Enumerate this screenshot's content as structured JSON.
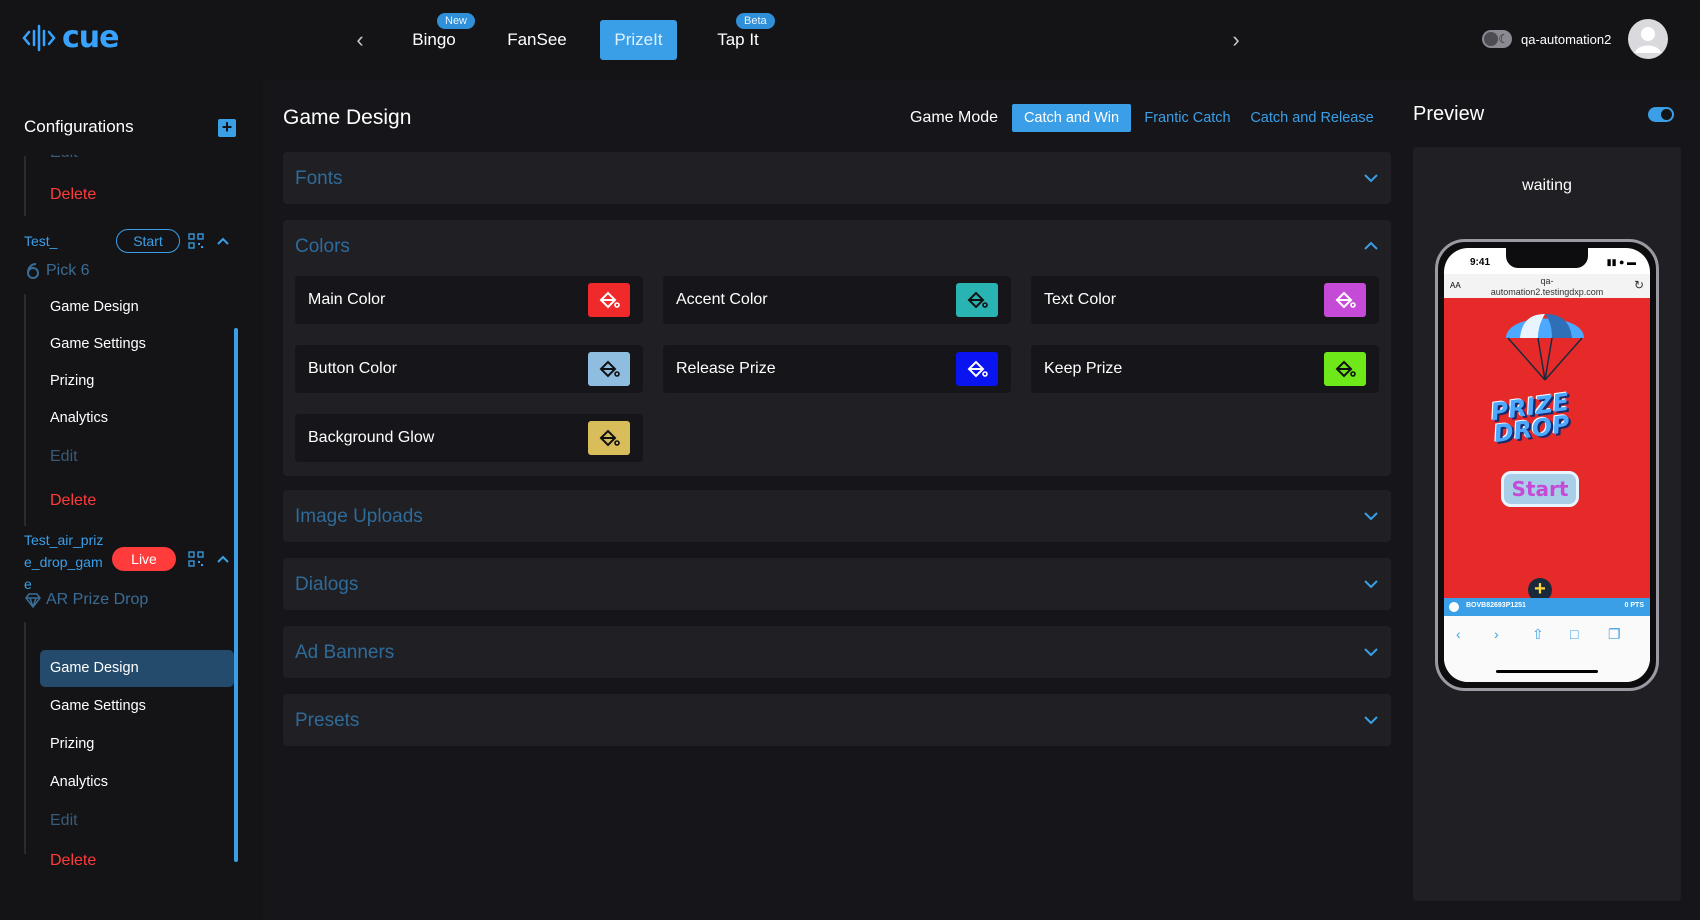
{
  "app": {
    "logo_text": "cue",
    "nav_tabs": [
      {
        "label": "Bingo",
        "badge": "New"
      },
      {
        "label": "FanSee",
        "badge": ""
      },
      {
        "label": "PrizeIt",
        "badge": ""
      },
      {
        "label": "Tap It",
        "badge": "Beta"
      }
    ],
    "username": "qa-automation2"
  },
  "sidebar": {
    "title": "Configurations",
    "top_partial_item": "Edit",
    "top_delete": "Delete",
    "projects": [
      {
        "name": "Test_",
        "status": "Start",
        "game": "Pick 6",
        "items": [
          "Game Design",
          "Game Settings",
          "Prizing",
          "Analytics"
        ],
        "edit": "Edit",
        "delete": "Delete"
      },
      {
        "name": "Test_air_prize_drop_game",
        "name_lines": [
          "Test_air_priz",
          "e_drop_gam",
          "e"
        ],
        "status": "Live",
        "game": "AR Prize Drop",
        "items": [
          "Game Design",
          "Game Settings",
          "Prizing",
          "Analytics"
        ],
        "edit": "Edit",
        "delete": "Delete",
        "active_item": "Game Design"
      }
    ]
  },
  "main": {
    "title": "Game Design",
    "game_mode_label": "Game Mode",
    "game_modes": [
      "Catch and Win",
      "Frantic Catch",
      "Catch and Release"
    ],
    "selected_mode": "Catch and Win",
    "panels": {
      "fonts": "Fonts",
      "colors": "Colors",
      "image_uploads": "Image Uploads",
      "dialogs": "Dialogs",
      "ad_banners": "Ad Banners",
      "presets": "Presets"
    },
    "colors": [
      {
        "label": "Main Color",
        "color": "#f02a2a"
      },
      {
        "label": "Accent Color",
        "color": "#2ab3b3"
      },
      {
        "label": "Text Color",
        "color": "#c64ad8"
      },
      {
        "label": "Button Color",
        "color": "#8fbde0"
      },
      {
        "label": "Release Prize",
        "color": "#0a14f0"
      },
      {
        "label": "Keep Prize",
        "color": "#6fe81a"
      },
      {
        "label": "Background Glow",
        "color": "#d9bd5a"
      }
    ]
  },
  "preview": {
    "title": "Preview",
    "status": "waiting",
    "phone": {
      "time": "9:41",
      "url_lines": [
        "qa-",
        "automation2.testingdxp.com"
      ],
      "url_aa": "AA",
      "game_logo_lines": [
        "PRIZE",
        "DROP"
      ],
      "start_label": "Start",
      "ticker_text": "BOVB82693P1251",
      "ticker_pts": "0 PTS"
    }
  }
}
